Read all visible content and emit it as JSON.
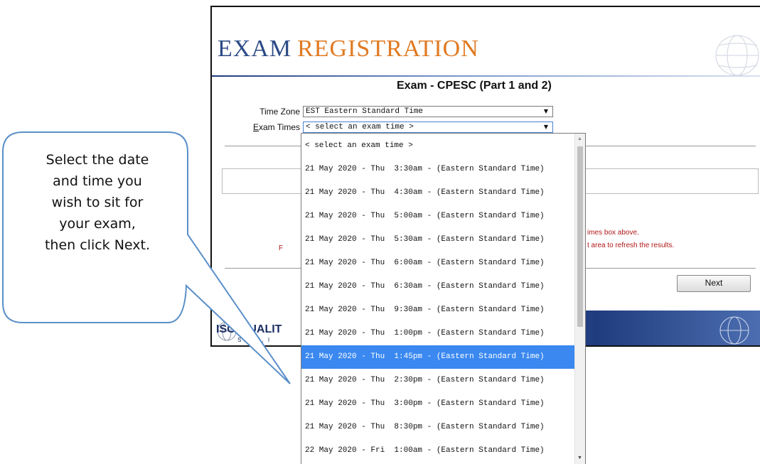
{
  "header": {
    "title_part1": "EXAM",
    "title_part2": "REGISTRATION",
    "exam_title": "Exam - CPESC (Part 1 and 2)"
  },
  "form": {
    "time_zone_label": "Time Zone",
    "exam_times_label_u": "E",
    "exam_times_label_rest": "xam Times",
    "time_zone_value": "EST Eastern Standard Time",
    "exam_times_value": "< select an exam time >"
  },
  "instructions": {
    "line1": "imes box above.",
    "line2": "t area to refresh the results.",
    "line_f": "F"
  },
  "next_label": "Next",
  "footer": {
    "logo": "ISO-QUALIT",
    "logo_sub": "STING, I"
  },
  "dropdown": {
    "options": [
      "< select an exam time >",
      "21 May 2020 - Thu  3:30am - (Eastern Standard Time)",
      "21 May 2020 - Thu  4:30am - (Eastern Standard Time)",
      "21 May 2020 - Thu  5:00am - (Eastern Standard Time)",
      "21 May 2020 - Thu  5:30am - (Eastern Standard Time)",
      "21 May 2020 - Thu  6:00am - (Eastern Standard Time)",
      "21 May 2020 - Thu  6:30am - (Eastern Standard Time)",
      "21 May 2020 - Thu  9:30am - (Eastern Standard Time)",
      "21 May 2020 - Thu  1:00pm - (Eastern Standard Time)",
      "21 May 2020 - Thu  1:45pm - (Eastern Standard Time)",
      "21 May 2020 - Thu  2:30pm - (Eastern Standard Time)",
      "21 May 2020 - Thu  3:00pm - (Eastern Standard Time)",
      "21 May 2020 - Thu  8:30pm - (Eastern Standard Time)",
      "22 May 2020 - Fri  1:00am - (Eastern Standard Time)"
    ],
    "selected_index": 9
  },
  "callout": {
    "lines": [
      "Select the date",
      "and time you",
      "wish to sit for",
      "your exam,",
      "then click Next."
    ]
  },
  "colors": {
    "brand_blue": "#2c4a86",
    "brand_orange": "#e07a22",
    "selection": "#3a88f0",
    "instruction_red": "#b01818"
  }
}
